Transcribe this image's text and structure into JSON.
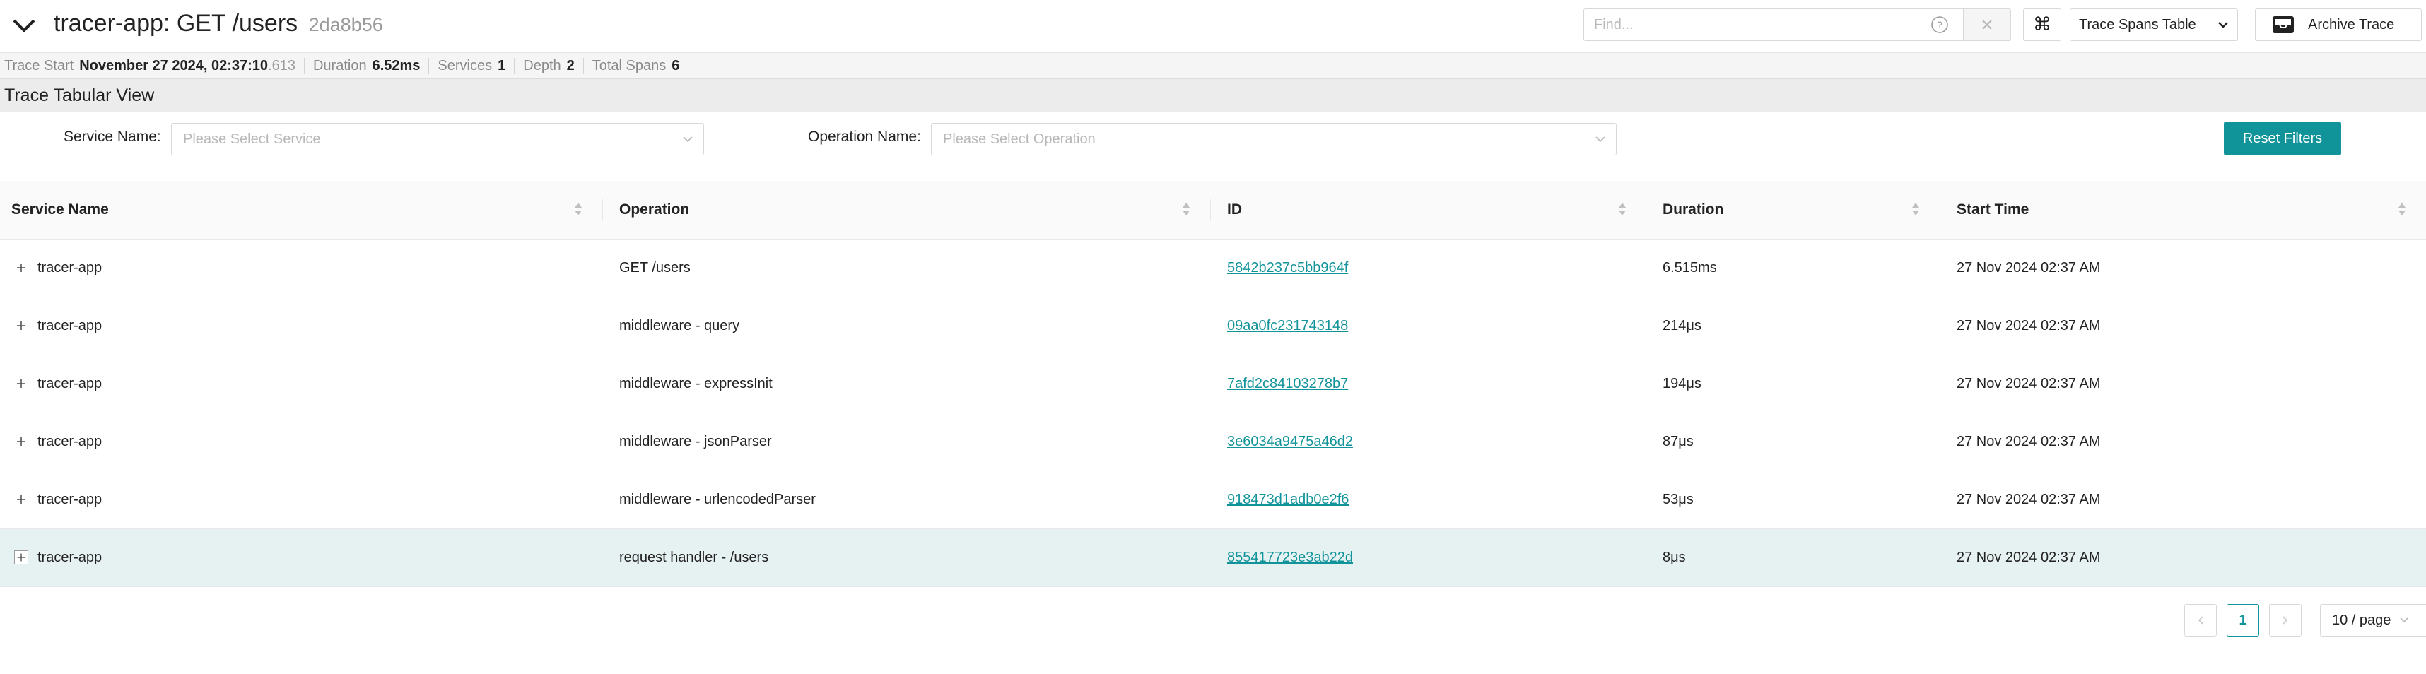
{
  "header": {
    "title": "tracer-app: GET /users",
    "trace_id_short": "2da8b56",
    "find_placeholder": "Find...",
    "view_select_value": "Trace Spans Table",
    "archive_label": "Archive Trace"
  },
  "summary": {
    "trace_start_label": "Trace Start",
    "trace_start_value": "November 27 2024, 02:37:10",
    "trace_start_ms": ".613",
    "duration_label": "Duration",
    "duration_value": "6.52ms",
    "services_label": "Services",
    "services_value": "1",
    "depth_label": "Depth",
    "depth_value": "2",
    "total_spans_label": "Total Spans",
    "total_spans_value": "6"
  },
  "section": {
    "title": "Trace Tabular View"
  },
  "filters": {
    "service_label": "Service Name",
    "service_placeholder": "Please Select Service",
    "operation_label": "Operation Name",
    "operation_placeholder": "Please Select Operation",
    "reset_label": "Reset Filters"
  },
  "table": {
    "columns": [
      "Service Name",
      "Operation",
      "ID",
      "Duration",
      "Start Time"
    ],
    "rows": [
      {
        "service": "tracer-app",
        "operation": "GET /users",
        "id": "5842b237c5bb964f",
        "duration": "6.515ms",
        "start": "27 Nov 2024 02:37 AM"
      },
      {
        "service": "tracer-app",
        "operation": "middleware - query",
        "id": "09aa0fc231743148",
        "duration": "214μs",
        "start": "27 Nov 2024 02:37 AM"
      },
      {
        "service": "tracer-app",
        "operation": "middleware - expressInit",
        "id": "7afd2c84103278b7",
        "duration": "194μs",
        "start": "27 Nov 2024 02:37 AM"
      },
      {
        "service": "tracer-app",
        "operation": "middleware - jsonParser",
        "id": "3e6034a9475a46d2",
        "duration": "87μs",
        "start": "27 Nov 2024 02:37 AM"
      },
      {
        "service": "tracer-app",
        "operation": "middleware - urlencodedParser",
        "id": "918473d1adb0e2f6",
        "duration": "53μs",
        "start": "27 Nov 2024 02:37 AM"
      },
      {
        "service": "tracer-app",
        "operation": "request handler - /users",
        "id": "855417723e3ab22d",
        "duration": "8μs",
        "start": "27 Nov 2024 02:37 AM"
      }
    ]
  },
  "pagination": {
    "current_page": "1",
    "page_size": "10 / page"
  },
  "colors": {
    "accent": "#11939a",
    "selected_row": "#e6f2f1"
  }
}
